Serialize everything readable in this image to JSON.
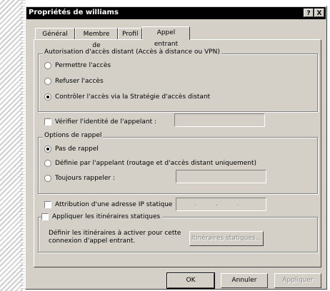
{
  "window": {
    "title": "Propriétés de williams",
    "help_button": "?",
    "close_button": "X"
  },
  "tabs": [
    {
      "label": "Général"
    },
    {
      "label": "Membre de"
    },
    {
      "label": "Profil"
    },
    {
      "label": "Appel entrant",
      "active": true
    }
  ],
  "remote_access": {
    "legend": "Autorisation d'accès distant (Accès à distance ou VPN)",
    "options": [
      {
        "label": "Permettre l'accès",
        "selected": false
      },
      {
        "label": "Refuser l'accès",
        "selected": false
      },
      {
        "label": "Contrôler l'accès via la Stratégie d'accès distant",
        "selected": true
      }
    ]
  },
  "verify_caller": {
    "label": "Vérifier l'identité de l'appelant :",
    "checked": false,
    "value": ""
  },
  "callback": {
    "legend": "Options de rappel",
    "options": [
      {
        "label": "Pas de rappel",
        "selected": true
      },
      {
        "label": "Définie par l'appelant (routage et d'accès distant uniquement)",
        "selected": false
      },
      {
        "label": "Toujours rappeler :",
        "selected": false
      }
    ],
    "always_value": ""
  },
  "static_ip": {
    "label": "Attribution d'une adresse IP statique",
    "checked": false,
    "value": ". . ."
  },
  "static_routes": {
    "label": "Appliquer les itinéraires statiques",
    "checked": false,
    "description": "Définir les itinéraires à activer pour cette connexion d'appel entrant.",
    "button": "Itinéraires statiques..."
  },
  "footer": {
    "ok": "OK",
    "cancel": "Annuler",
    "apply": "Appliquer"
  }
}
